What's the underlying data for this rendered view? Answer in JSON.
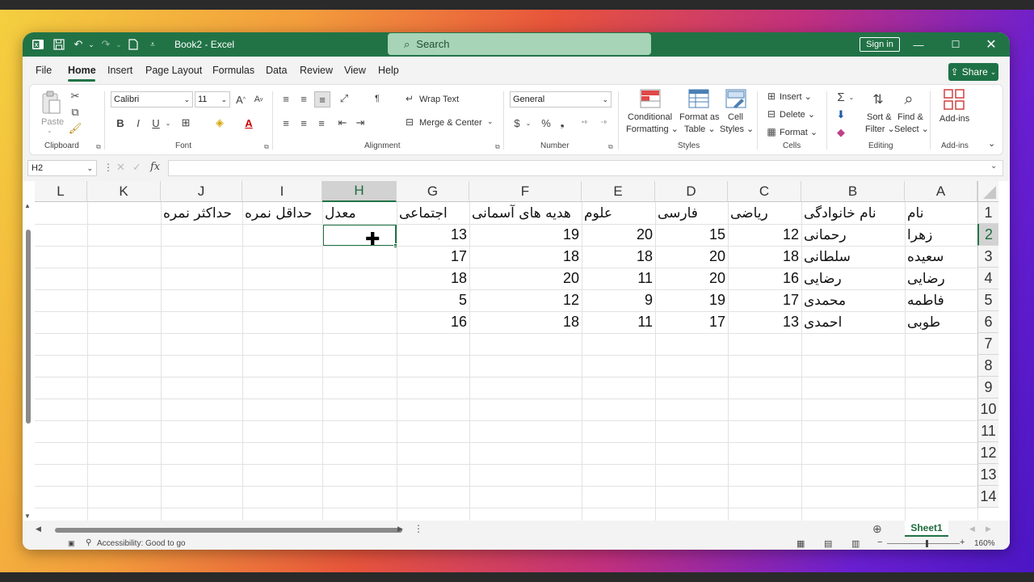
{
  "app": {
    "title": "Book2 - Excel",
    "search_placeholder": "Search",
    "signin_label": "Sign in",
    "share_label": "Share"
  },
  "menu": [
    "File",
    "Home",
    "Insert",
    "Page Layout",
    "Formulas",
    "Data",
    "Review",
    "View",
    "Help"
  ],
  "ribbon": {
    "clipboard": {
      "paste": "Paste",
      "group": "Clipboard"
    },
    "font": {
      "name": "Calibri",
      "size": "11",
      "group": "Font"
    },
    "alignment": {
      "wrap": "Wrap Text",
      "merge": "Merge & Center",
      "group": "Alignment"
    },
    "number": {
      "format": "General",
      "group": "Number"
    },
    "styles": {
      "conditional": "Conditional",
      "conditional2": "Formatting",
      "format_as": "Format as",
      "format_as2": "Table",
      "cell": "Cell",
      "cell2": "Styles",
      "group": "Styles"
    },
    "cells": {
      "insert": "Insert",
      "delete": "Delete",
      "format": "Format",
      "group": "Cells"
    },
    "editing": {
      "sort": "Sort &",
      "sort2": "Filter",
      "find": "Find &",
      "find2": "Select",
      "group": "Editing"
    },
    "addins": {
      "label": "Add-ins",
      "group": "Add-ins"
    }
  },
  "formula_bar": {
    "name_box": "H2",
    "fx": "fx",
    "formula": ""
  },
  "sheet": {
    "columns": [
      "L",
      "K",
      "J",
      "I",
      "H",
      "G",
      "F",
      "E",
      "D",
      "C",
      "B",
      "A"
    ],
    "selected_column": "H",
    "rows": [
      "1",
      "2",
      "3",
      "4",
      "5",
      "6",
      "7",
      "8",
      "9",
      "10",
      "11",
      "12",
      "13",
      "14"
    ],
    "selected_row": "2",
    "header_row": {
      "A": "نام",
      "B": "نام خانوادگی",
      "C": "ریاضی",
      "D": "فارسی",
      "E": "علوم",
      "F": "هدیه های آسمانی",
      "G": "اجتماعی",
      "H": "معدل",
      "I": "حداقل نمره",
      "J": "حداکثر نمره"
    },
    "data_rows": [
      {
        "A": "زهرا",
        "B": "رحمانی",
        "C": "12",
        "D": "15",
        "E": "20",
        "F": "19",
        "G": "13"
      },
      {
        "A": "سعیده",
        "B": "سلطانی",
        "C": "18",
        "D": "20",
        "E": "18",
        "F": "18",
        "G": "17"
      },
      {
        "A": "رضایی",
        "B": "رضایی",
        "C": "16",
        "D": "20",
        "E": "11",
        "F": "20",
        "G": "18"
      },
      {
        "A": "فاطمه",
        "B": "محمدی",
        "C": "17",
        "D": "19",
        "E": "9",
        "F": "12",
        "G": "5"
      },
      {
        "A": "طوبی",
        "B": "احمدی",
        "C": "13",
        "D": "17",
        "E": "11",
        "F": "18",
        "G": "16"
      }
    ],
    "tab_name": "Sheet1"
  },
  "status": {
    "accessibility": "Accessibility: Good to go",
    "zoom": "160%"
  }
}
